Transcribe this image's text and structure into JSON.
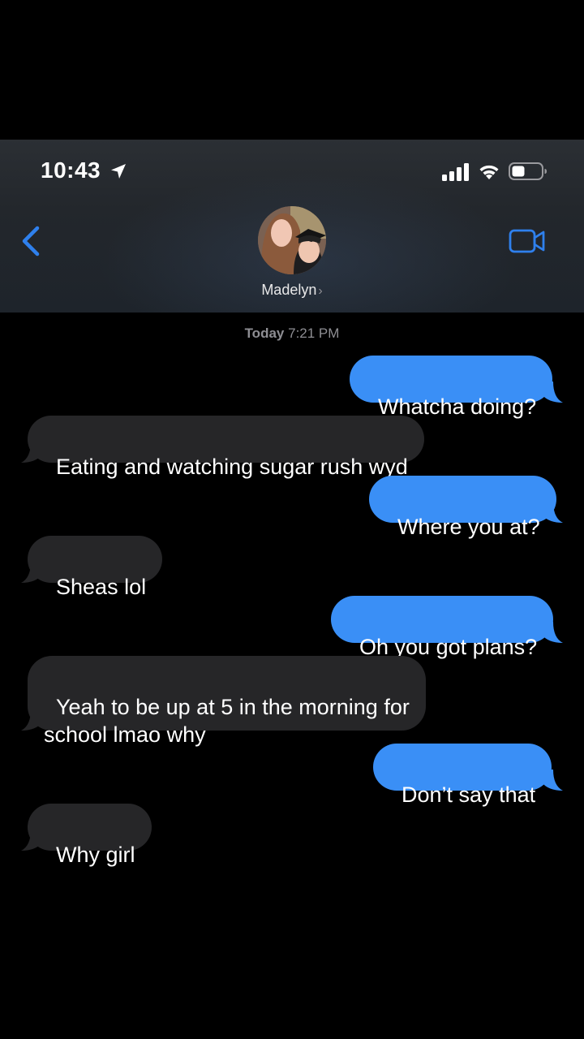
{
  "status_bar": {
    "time": "10:43",
    "icons": [
      "location-arrow-icon",
      "cellular-signal-icon",
      "wifi-icon",
      "battery-icon"
    ]
  },
  "header": {
    "contact_name": "Madelyn",
    "chevron": "›",
    "back_icon": "chevron-left-icon",
    "video_icon": "video-camera-icon"
  },
  "conversation": {
    "timestamp_day": "Today",
    "timestamp_time": "7:21 PM",
    "messages": [
      {
        "from": "me",
        "text": "Whatcha doing?"
      },
      {
        "from": "them",
        "text": "Eating and watching sugar rush wyd"
      },
      {
        "from": "me",
        "text": "Where you at?"
      },
      {
        "from": "them",
        "text": "Sheas lol"
      },
      {
        "from": "me",
        "text": "Oh you got plans?"
      },
      {
        "from": "them",
        "text": "Yeah to be up at 5 in the morning for\nschool lmao why"
      },
      {
        "from": "me",
        "text": "Don’t say that"
      },
      {
        "from": "them",
        "text": "Why girl"
      }
    ]
  },
  "colors": {
    "sent_bubble": "#3a8ff6",
    "received_bubble": "#262628",
    "accent_blue": "#2f80ed",
    "timestamp_gray": "#8e8e93"
  }
}
